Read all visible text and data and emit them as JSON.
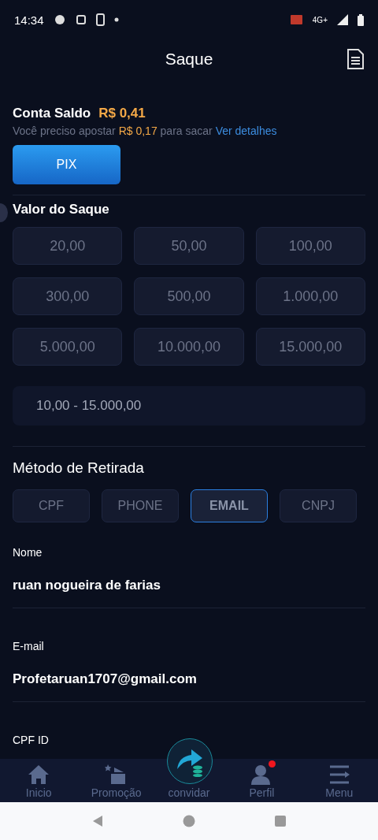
{
  "status_bar": {
    "time": "14:34",
    "network": "4G+"
  },
  "header": {
    "title": "Saque"
  },
  "balance": {
    "label": "Conta Saldo",
    "amount": "R$ 0,41",
    "notice": "Você preciso apostar",
    "notice_amount": "R$ 0,17",
    "notice_suffix": "para sacar",
    "details_link": "Ver detalhes"
  },
  "channels": [
    {
      "label": "PIX",
      "selected": true
    }
  ],
  "amount_section": {
    "title": "Valor do Saque",
    "options": [
      {
        "label": "20,00",
        "selected": false
      },
      {
        "label": "50,00",
        "selected": false
      },
      {
        "label": "100,00",
        "selected": false
      },
      {
        "label": "300,00",
        "selected": false
      },
      {
        "label": "500,00",
        "selected": false
      },
      {
        "label": "1.000,00",
        "selected": false
      },
      {
        "label": "5.000,00",
        "selected": false
      },
      {
        "label": "10.000,00",
        "selected": false
      },
      {
        "label": "15.000,00",
        "selected": false
      }
    ],
    "input": {
      "placeholder": "10,00 - 15.000,00"
    }
  },
  "method_section": {
    "title": "Método de Retirada",
    "methods": [
      {
        "label": "CPF",
        "selected": false
      },
      {
        "label": "PHONE",
        "selected": false
      },
      {
        "label": "EMAIL",
        "selected": true
      },
      {
        "label": "CNPJ",
        "selected": false
      }
    ]
  },
  "fields": [
    {
      "label": "Nome",
      "value": "ruan nogueira de farias"
    },
    {
      "label": "E-mail",
      "value": "Profetaruan1707@gmail.com"
    },
    {
      "label": "CPF ID"
    }
  ],
  "bottom_nav": [
    {
      "label": "Inicio",
      "kind": "home",
      "notification": false
    },
    {
      "label": "Promoção",
      "kind": "promo",
      "notification": false
    },
    {
      "label": "convidar",
      "kind": "invite",
      "notification": false
    },
    {
      "label": "Perfil",
      "kind": "profile",
      "notification": true
    },
    {
      "label": "Menu",
      "kind": "menu",
      "notification": false
    }
  ]
}
